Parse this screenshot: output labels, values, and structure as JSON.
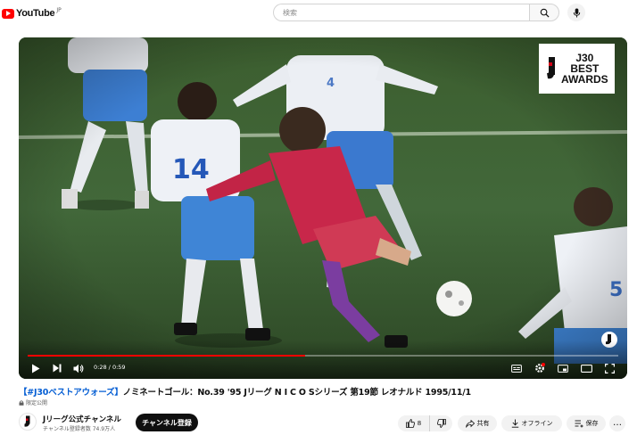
{
  "header": {
    "logo_text": "YouTube",
    "logo_sup": "JP",
    "search_placeholder": "検索"
  },
  "player": {
    "badge_lines": [
      "J30",
      "BEST",
      "AWARDS"
    ],
    "time_current": "0:28",
    "time_total": "0:59",
    "progress": 0.47,
    "accent_color": "#ff0000"
  },
  "video": {
    "title_hashtag": "【#J30ベストアウォーズ】",
    "title_rest": "ノミネートゴール：No.39 '95 Jリーグ N I C O Sシリーズ 第19節 レオナルド 1995/11/1",
    "visibility": "限定公開"
  },
  "channel": {
    "name": "Jリーグ公式チャンネル",
    "subscribers": "チャンネル登録者数 74.9万人",
    "subscribe_label": "チャンネル登録"
  },
  "actions": {
    "like_count": "8",
    "share_label": "共有",
    "offline_label": "オフライン",
    "save_label": "保存",
    "more_label": "…"
  },
  "icons": [
    "youtube-logo-icon",
    "search-icon",
    "mic-icon",
    "play-icon",
    "next-icon",
    "volume-icon",
    "subtitles-icon",
    "settings-icon",
    "miniplayer-icon",
    "theater-icon",
    "fullscreen-icon",
    "like-icon",
    "dislike-icon",
    "share-icon",
    "download-icon",
    "save-icon",
    "more-icon",
    "lock-icon"
  ]
}
